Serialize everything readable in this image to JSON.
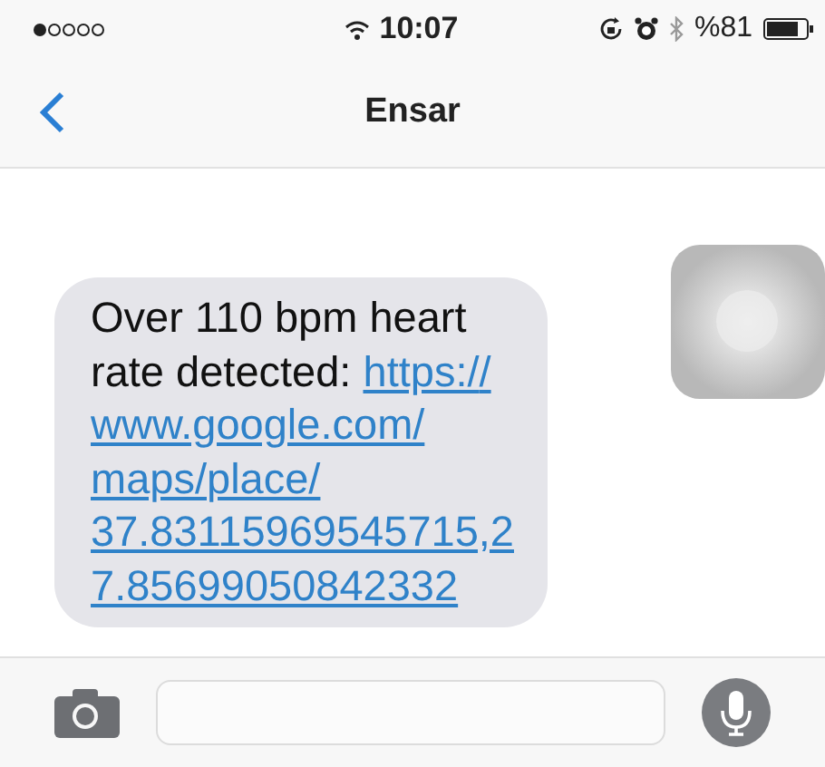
{
  "status_bar": {
    "time": "10:07",
    "battery_text": "%81"
  },
  "nav": {
    "title": "Ensar"
  },
  "messages": [
    {
      "kind": "incoming",
      "text": "Over 110 bpm heart rate detected: ",
      "link": "https://www.google.com/maps/place/37.83115969545715,27.85699050842332"
    },
    {
      "kind": "attachment"
    }
  ]
}
